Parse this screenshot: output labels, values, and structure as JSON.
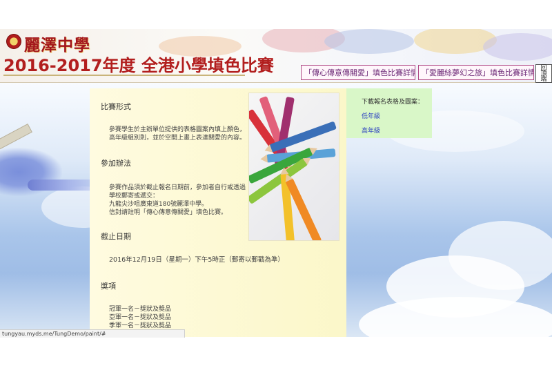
{
  "header": {
    "school_name": "麗澤中學",
    "contest_title": "2016-2017年度 全港小學填色比賽",
    "links": [
      {
        "label": "「傳心傳意傳關愛」填色比賽詳情"
      },
      {
        "label": "「愛麗絲夢幻之旅」填色比賽詳情"
      }
    ],
    "back_to_top": "回頂端"
  },
  "content": {
    "sections": [
      {
        "heading": "比賽形式",
        "lines": [
          "參賽學生於主辦單位提供的表格圖案內填上顏色，",
          "高年級組別則，並於空間上畫上表達關愛的內容。"
        ]
      },
      {
        "heading": "參加辦法",
        "lines": [
          "參賽作品須於截止報名日期前，參加者自行或透過",
          "學校郵寄或遞交：",
          "九龍尖沙咀廣東道180號麗澤中學。",
          "信封請註明「傳心傳意傳關愛」填色比賽。"
        ]
      },
      {
        "heading": "截止日期",
        "lines": [
          "2016年12月19日（星期一）下午5時正（郵寄以郵戳為準）"
        ]
      },
      {
        "heading": "獎項",
        "lines": [
          "冠軍一名－獎狀及獎品",
          "亞軍一名－獎狀及獎品",
          "季軍一名－獎狀及獎品"
        ]
      }
    ]
  },
  "sidebar": {
    "heading": "下載報名表格及圖案：",
    "links": [
      {
        "label": "低年級"
      },
      {
        "label": "高年級"
      }
    ]
  },
  "status_bar": {
    "url": "tungyau.myds.me/TungDemo/paint/#"
  },
  "icons": {
    "crest": "school-crest-icon",
    "photo": "colored-pencils-image"
  },
  "colors": {
    "title_red": "#b21e1e",
    "content_bg": "#fffbe0",
    "sidebar_bg": "#d9f7c8",
    "link_blue": "#2a3fc0"
  }
}
